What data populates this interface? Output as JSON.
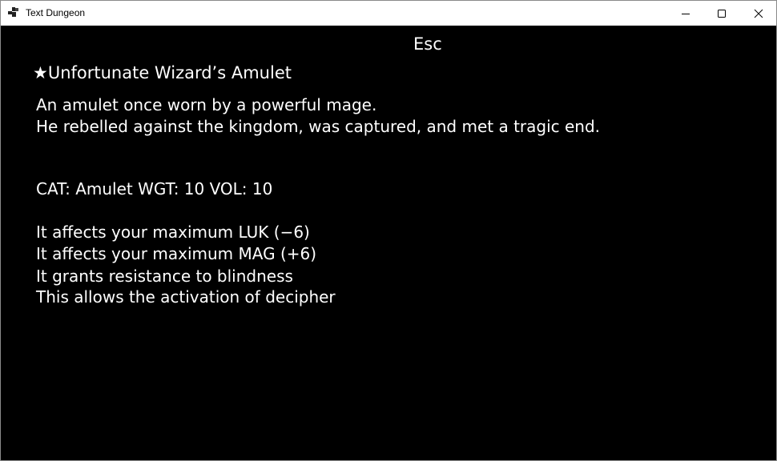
{
  "window": {
    "title": "Text Dungeon",
    "app_icon": "window-app-icon",
    "controls": {
      "minimize_icon": "minimize-icon",
      "maximize_icon": "maximize-icon",
      "close_icon": "close-icon"
    }
  },
  "colors": {
    "background": "#000000",
    "text": "#ffffff",
    "titlebar": "#ffffff"
  },
  "screen": {
    "esc_label": "Esc",
    "item": {
      "name": "★Unfortunate Wizard’s Amulet",
      "description": [
        "An amulet once worn by a powerful mage.",
        "He rebelled against the kingdom, was captured, and met a tragic end."
      ],
      "stats": "CAT: Amulet  WGT: 10  VOL: 10",
      "effects": [
        "It affects your maximum LUK (−6)",
        "It affects your maximum MAG (+6)",
        "It grants resistance to blindness",
        "This allows the activation of decipher"
      ]
    }
  }
}
